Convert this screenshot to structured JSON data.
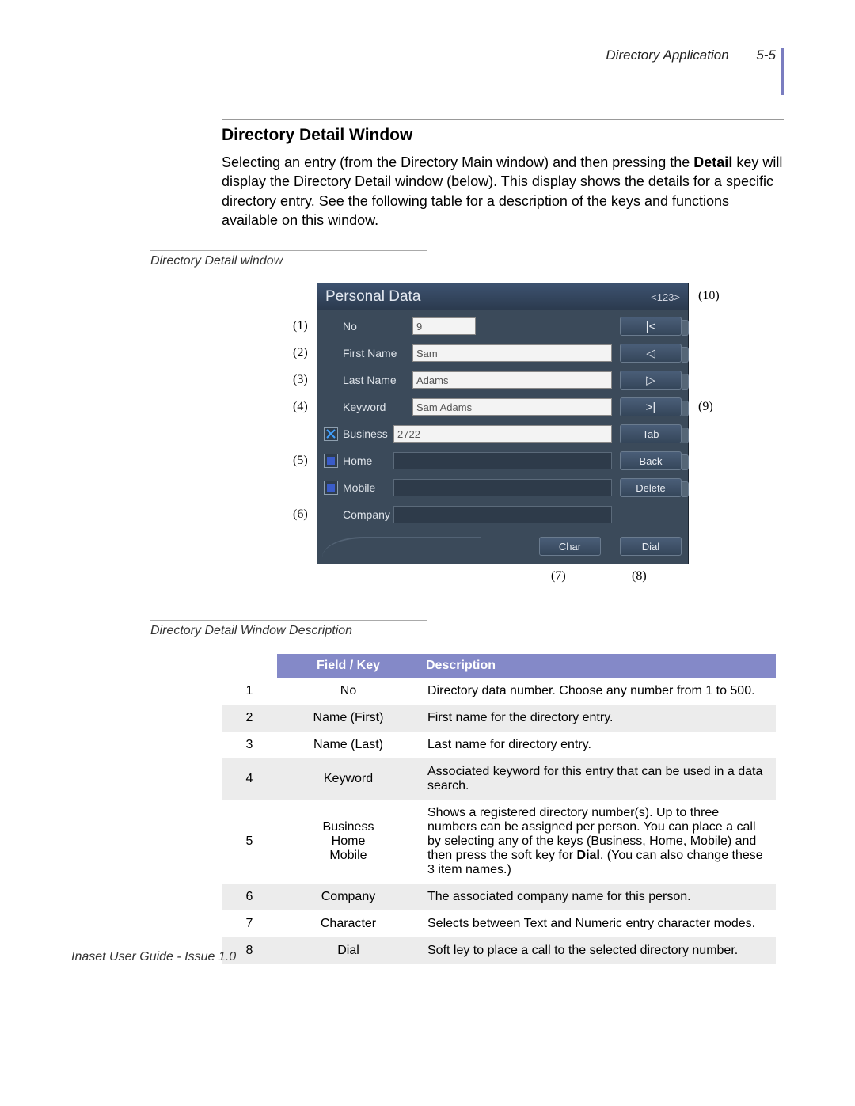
{
  "header": {
    "chapter_title": "Directory Application",
    "page_number": "5-5"
  },
  "section": {
    "title": "Directory Detail Window",
    "body_pre": "Selecting an entry (from the Directory Main window) and then pressing the ",
    "body_bold": "Detail",
    "body_post": " key will display the Directory Detail window (below). This display shows the details for a specific directory entry. See the following table for a description of the keys and functions available on this window."
  },
  "figure_caption": "Directory Detail window",
  "phone": {
    "title": "Personal Data",
    "mode_indicator": "<123>",
    "rows": [
      {
        "label": "No",
        "value": "9"
      },
      {
        "label": "First Name",
        "value": "Sam"
      },
      {
        "label": "Last Name",
        "value": "Adams"
      },
      {
        "label": "Keyword",
        "value": "Sam Adams"
      },
      {
        "label": "Business",
        "value": "2722"
      },
      {
        "label": "Home",
        "value": ""
      },
      {
        "label": "Mobile",
        "value": ""
      },
      {
        "label": "Company",
        "value": ""
      }
    ],
    "side_buttons": [
      "|<",
      "◁",
      "▷",
      ">|",
      "Tab",
      "Back",
      "Delete"
    ],
    "bottom_buttons": [
      "Char",
      "Dial"
    ]
  },
  "markers": {
    "left": [
      "(1)",
      "(2)",
      "(3)",
      "(4)",
      "(5)",
      "(6)"
    ],
    "right_top": "(10)",
    "right_mid": "(9)",
    "bottom": [
      "(7)",
      "(8)"
    ]
  },
  "table_caption": "Directory Detail Window Description",
  "table": {
    "headers": {
      "field_key": "Field / Key",
      "description": "Description"
    },
    "rows": [
      {
        "n": "1",
        "fk": "No",
        "desc": "Directory data number. Choose any number from 1 to 500."
      },
      {
        "n": "2",
        "fk": "Name (First)",
        "desc": "First name for the directory entry."
      },
      {
        "n": "3",
        "fk": "Name (Last)",
        "desc": "Last name for directory entry."
      },
      {
        "n": "4",
        "fk": "Keyword",
        "desc": "Associated keyword for this entry that can be used in a data search."
      },
      {
        "n": "5",
        "fk": "Business\nHome\nMobile",
        "desc_pre": "Shows a registered directory number(s). Up to three numbers can be assigned per person. You can place a call by selecting any of the keys (Business, Home, Mobile) and then press the soft key for ",
        "desc_bold": "Dial",
        "desc_post": ". (You can also change these 3 item names.)"
      },
      {
        "n": "6",
        "fk": "Company",
        "desc": "The associated company name for this person."
      },
      {
        "n": "7",
        "fk": "Character",
        "desc": "Selects between Text and Numeric entry character modes."
      },
      {
        "n": "8",
        "fk": "Dial",
        "desc": "Soft ley to place a call to the selected directory number."
      }
    ]
  },
  "footer": "Inaset User Guide - Issue 1.0"
}
